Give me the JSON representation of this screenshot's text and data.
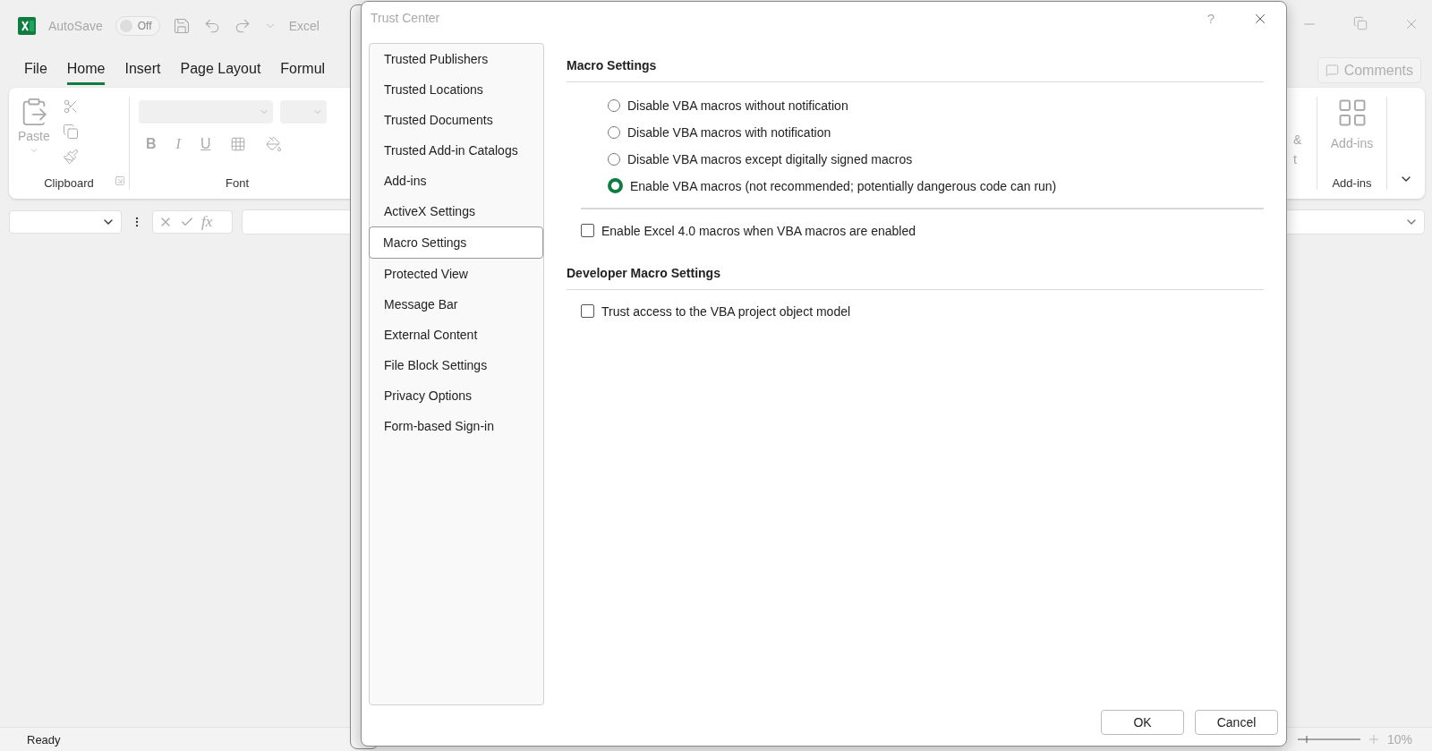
{
  "excel": {
    "title_bar": {
      "autosave_label": "AutoSave",
      "autosave_toggle": {
        "on": false,
        "label": "Off"
      },
      "document_title": "Excel"
    },
    "ribbon_tabs": [
      {
        "label": "File",
        "selected": false
      },
      {
        "label": "Home",
        "selected": true
      },
      {
        "label": "Insert",
        "selected": false
      },
      {
        "label": "Page Layout",
        "selected": false
      },
      {
        "label": "Formul",
        "selected": false
      }
    ],
    "comments_button": "Comments",
    "ribbon": {
      "clipboard": {
        "paste_label": "Paste",
        "group_label": "Clipboard"
      },
      "font": {
        "group_label": "Font",
        "format_buttons": [
          {
            "kind": "bold",
            "label": "B"
          },
          {
            "kind": "italic",
            "label": "I"
          },
          {
            "kind": "underline",
            "label": "U"
          }
        ]
      },
      "cut_group_text": [
        "&",
        "t"
      ],
      "addins": {
        "button_label": "Add-ins",
        "group_label": "Add-ins"
      }
    },
    "formula_bar": {
      "fx_label": "fx"
    },
    "status_bar": {
      "status": "Ready",
      "zoom": "10%"
    }
  },
  "dialog": {
    "title": "Trust Center",
    "help": "?",
    "nav_items": [
      {
        "label": "Trusted Publishers",
        "selected": false
      },
      {
        "label": "Trusted Locations",
        "selected": false
      },
      {
        "label": "Trusted Documents",
        "selected": false
      },
      {
        "label": "Trusted Add-in Catalogs",
        "selected": false
      },
      {
        "label": "Add-ins",
        "selected": false
      },
      {
        "label": "ActiveX Settings",
        "selected": false
      },
      {
        "label": "Macro Settings",
        "selected": true
      },
      {
        "label": "Protected View",
        "selected": false
      },
      {
        "label": "Message Bar",
        "selected": false
      },
      {
        "label": "External Content",
        "selected": false
      },
      {
        "label": "File Block Settings",
        "selected": false
      },
      {
        "label": "Privacy Options",
        "selected": false
      },
      {
        "label": "Form-based Sign-in",
        "selected": false
      }
    ],
    "sections": [
      {
        "heading": "Macro Settings",
        "radio_group": [
          {
            "label": "Disable VBA macros without notification",
            "selected": false
          },
          {
            "label": "Disable VBA macros with notification",
            "selected": false
          },
          {
            "label": "Disable VBA macros except digitally signed macros",
            "selected": false
          },
          {
            "label": "Enable VBA macros (not recommended; potentially dangerous code can run)",
            "selected": true
          }
        ],
        "checkboxes": [
          {
            "label": "Enable Excel 4.0 macros when VBA macros are enabled",
            "checked": false
          }
        ]
      },
      {
        "heading": "Developer Macro Settings",
        "checkboxes": [
          {
            "label": "Trust access to the VBA project object model",
            "checked": false
          }
        ]
      }
    ],
    "buttons": [
      "OK",
      "Cancel"
    ]
  }
}
